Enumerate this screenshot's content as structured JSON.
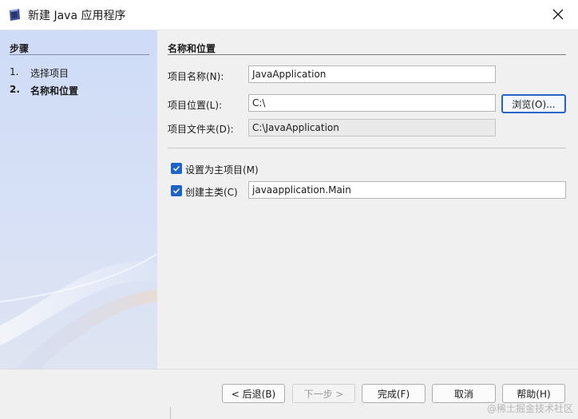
{
  "window": {
    "title": "新建 Java 应用程序",
    "icon": "netbeans-app-icon",
    "close_icon": "close-icon"
  },
  "sidebar": {
    "heading": "步骤",
    "steps": [
      {
        "num": "1.",
        "label": "选择项目"
      },
      {
        "num": "2.",
        "label": "名称和位置"
      }
    ]
  },
  "main": {
    "heading": "名称和位置",
    "project_name": {
      "label": "项目名称(N):",
      "value": "JavaApplication"
    },
    "project_location": {
      "label": "项目位置(L):",
      "value": "C:\\",
      "browse_label": "浏览(O)..."
    },
    "project_folder": {
      "label": "项目文件夹(D):",
      "value": "C:\\JavaApplication"
    },
    "set_main_project": {
      "label": "设置为主项目(M)",
      "checked": true
    },
    "create_main_class": {
      "label": "创建主类(C)",
      "checked": true,
      "value": "javaapplication.Main"
    }
  },
  "footer": {
    "back_label": "< 后退(B)",
    "next_label": "下一步 >",
    "finish_label": "完成(F)",
    "cancel_label": "取消",
    "help_label": "帮助(H)"
  },
  "watermark": "@稀土掘金技术社区",
  "colors": {
    "accent": "#1e63c8",
    "sidebar": "#d3def6"
  }
}
